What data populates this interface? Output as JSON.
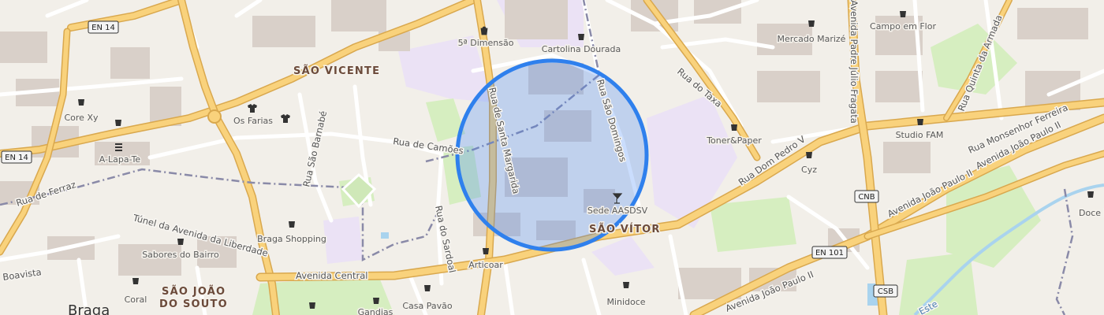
{
  "map": {
    "city": "Braga",
    "districts": {
      "sao_vicente": "SÃO VICENTE",
      "sao_vitor": "SÃO VÍTOR",
      "sao_joao_1": "SÃO JOÃO",
      "sao_joao_2": "DO SOUTO"
    },
    "streets": {
      "rua_santa_margarida": "Rua de Santa Margarida",
      "rua_sao_domingos": "Rua São Domingos",
      "rua_do_taxa": "Rua do Taxa",
      "rua_camoes": "Rua de Camões",
      "rua_sao_barnabe": "Rua São Barnabé",
      "rua_ferraz": "Rua de Ferraz",
      "tunel": "Túnel da Avenida da Liberdade",
      "rua_sardoal": "Rua do Sardoal",
      "avenida_central": "Avenida Central",
      "rua_dom_pedro": "Rua Dom Pedro V",
      "av_joao_paulo_1": "Avenida João Paulo II",
      "av_joao_paulo_2": "Avenida João Paulo II",
      "av_joao_paulo_3": "Avenida João Paulo II",
      "rua_monsenhor": "Rua Monsenhor Ferreira",
      "rua_padre_julio": "Avenida Padre Júlio Fragata",
      "rua_quinta_armada": "Rua Quinta da Armada",
      "boavista": "Boavista",
      "este": "Este"
    },
    "shields": {
      "en14_top": "EN 14",
      "en14_left": "EN 14",
      "cnb": "CNB",
      "en101": "EN 101",
      "csb": "CSB"
    },
    "pois": {
      "dimensao": "5ª Dimensão",
      "cartolina": "Cartolina Dourada",
      "mercado": "Mercado Marizé",
      "campo": "Campo em Flor",
      "core": "Core Xy",
      "os_farias": "Os Farias",
      "alapa": "A-Lapa-Te",
      "toner": "Toner&Paper",
      "studio": "Studio FAM",
      "cyz": "Cyz",
      "sede": "Sede AASDSV",
      "braga_shopping": "Braga Shopping",
      "sabores": "Sabores do Bairro",
      "articoar": "Articoar",
      "coral": "Coral",
      "casa_pavao": "Casa Pavão",
      "gandias": "Gandias",
      "minidoce": "Minidoce",
      "doce": "Doce R"
    },
    "colors": {
      "land": "#f2efe9",
      "road_major": "#f9d27c",
      "road_casing": "#d9a84e",
      "road_minor": "#ffffff",
      "building": "#d9d0c9",
      "school": "#ebe2f5",
      "park": "#d6eec0",
      "water": "#a9d3ee",
      "circle_fill": "#3b82f6",
      "circle_stroke": "#2f80ed"
    }
  }
}
